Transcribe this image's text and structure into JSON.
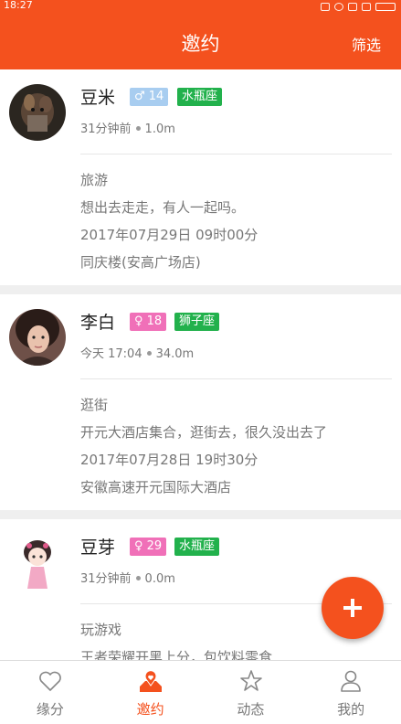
{
  "status_bar": {
    "time": "18:27"
  },
  "header": {
    "title": "邀约",
    "filter_label": "筛选"
  },
  "posts": [
    {
      "name": "豆米",
      "gender_badge": "♂ 14",
      "gender_color": "#a8cdf0",
      "zodiac": "水瓶座",
      "time": "31分钟前",
      "distance": "1.0m",
      "category": "旅游",
      "message": "想出去走走，有人一起吗。",
      "datetime": "2017年07月29日 09时00分",
      "location": "同庆楼(安高广场店)"
    },
    {
      "name": "李白",
      "gender_badge": "♀ 18",
      "gender_color": "#f070b8",
      "zodiac": "狮子座",
      "time": "今天 17:04",
      "distance": "34.0m",
      "category": "逛街",
      "message": "开元大酒店集合，逛街去，很久没出去了",
      "datetime": "2017年07月28日 19时30分",
      "location": "安徽高速开元国际大酒店"
    },
    {
      "name": "豆芽",
      "gender_badge": "♀ 29",
      "gender_color": "#f070b8",
      "zodiac": "水瓶座",
      "time": "31分钟前",
      "distance": "0.0m",
      "category": "玩游戏",
      "message": "王者荣耀开黑上分，包饮料零食"
    }
  ],
  "tabs": [
    {
      "label": "缘分",
      "icon": "heart-icon",
      "active": false
    },
    {
      "label": "邀约",
      "icon": "invite-map-pin-icon",
      "active": true
    },
    {
      "label": "动态",
      "icon": "star-icon",
      "active": false
    },
    {
      "label": "我的",
      "icon": "person-icon",
      "active": false
    }
  ],
  "colors": {
    "brand": "#f4511e",
    "zodiac_badge": "#22b14c",
    "male": "#a8cdf0",
    "female": "#f070b8"
  },
  "fab": {
    "icon": "plus-icon"
  }
}
